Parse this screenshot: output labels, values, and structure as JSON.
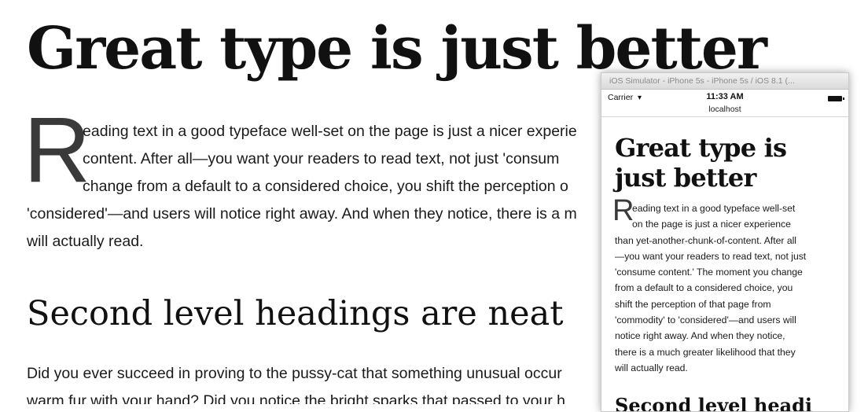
{
  "main": {
    "heading": "Great type is just better",
    "dropcap": "R",
    "lines": [
      "eading text in a good typeface well-set on the page is just a nicer experie",
      "content. After all—you want your readers to read text, not just 'consum",
      "change from a default to a considered choice, you shift the perception o",
      "'considered'—and users will notice right away. And when they notice, there is a m",
      "will actually read."
    ],
    "subheading": "Second level headings are neat",
    "lines2": [
      "Did you ever succeed in proving to the pussy-cat that something unusual occur",
      "warm fur with your hand? Did you notice the bright sparks that passed to your h"
    ]
  },
  "simulator": {
    "title": "iOS Simulator - iPhone 5s - iPhone 5s / iOS 8.1 (...",
    "carrier": "Carrier",
    "time": "11:33 AM",
    "host": "localhost",
    "heading_line1": "Great type is",
    "heading_line2": "just better",
    "dropcap": "R",
    "lines": [
      "eading text in a good typeface well-set",
      "on the page is just a nicer experience",
      "than yet-another-chunk-of-content. After all",
      "—you want your readers to read text, not just",
      "'consume content.' The moment you change",
      "from a default to a considered choice, you",
      "shift the perception of that page from",
      "'commodity' to 'considered'—and users will",
      "notice right away. And when they notice,",
      "there is a much greater likelihood that they",
      "will actually read."
    ],
    "subheading": "Second level headi"
  }
}
